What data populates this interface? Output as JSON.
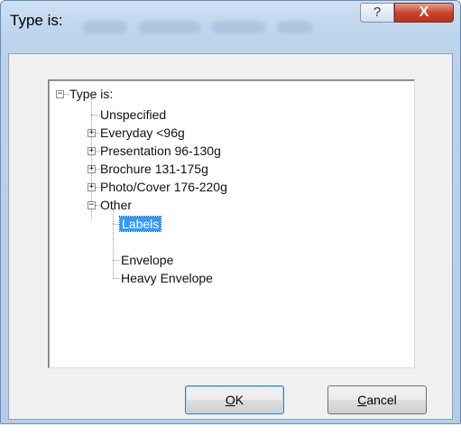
{
  "window": {
    "title": "Type is:"
  },
  "titlebar": {
    "help_label": "?",
    "close_label": "X"
  },
  "tree": {
    "root": {
      "label": "Type is:",
      "expander": "−"
    },
    "children": [
      {
        "label": "Unspecified"
      },
      {
        "label": "Everyday <96g",
        "expander": "+"
      },
      {
        "label": "Presentation 96-130g",
        "expander": "+"
      },
      {
        "label": "Brochure 131-175g",
        "expander": "+"
      },
      {
        "label": "Photo/Cover 176-220g",
        "expander": "+"
      },
      {
        "label": "Other",
        "expander": "−"
      }
    ],
    "other_children": [
      {
        "label": "Labels",
        "selected": true
      },
      {
        "label": "Envelope"
      },
      {
        "label": "Heavy Envelope"
      }
    ]
  },
  "buttons": {
    "ok": {
      "mnemonic": "O",
      "rest": "K"
    },
    "cancel": {
      "mnemonic": "C",
      "rest": "ancel"
    }
  }
}
